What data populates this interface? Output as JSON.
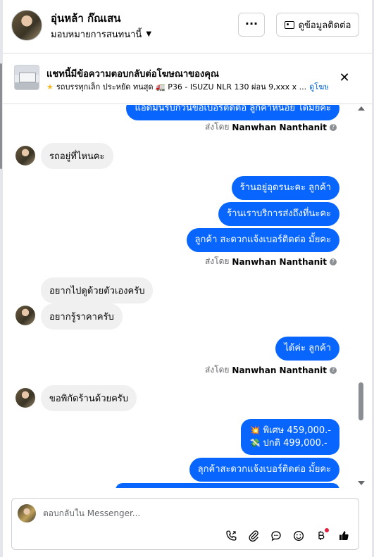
{
  "header": {
    "name": "อุ่นหล้า ก๊ณเสน",
    "subtitle": "มอบหมายการสนทนานี้",
    "more_label": "···",
    "contact_label": "ดูข้อมูลติดต่อ"
  },
  "ad_banner": {
    "title": "แชทนี้มีข้อความตอบกลับต่อโฆษณาของคุณ",
    "description": "รถบรรทุกเล็ก ประหยัด ทนสุด 🚛 P36 - ISUZU NLR 130 ผ่อน 9,xxx x ...",
    "link": "ดูโฆษณา"
  },
  "messages": {
    "out_partial": "แอดมินรบกวนขอเบอร์ติดต่อ ลูกค้าหน่อย ได้มั้ยคะ",
    "sent_by_label": "ส่งโดย",
    "agent_name": "Nanwhan Nanthanit",
    "in_1": "รถอยู่ที่ไหนคะ",
    "out_2": "ร้านอยู่อุดรนะคะ ลูกค้า",
    "out_3": "ร้านเราบริการส่งถึงที่นะคะ",
    "out_4": "ลูกค้า สะดวกแจ้งเบอร์ติดต่อ มั้ยคะ",
    "in_2": "อยากไปดูด้วยตัวเองครับ",
    "in_3": "อยากรู้ราคาครับ",
    "out_5": "ได้ค่ะ ลูกค้า",
    "in_4": "ขอพิกัดร้านด้วยครับ",
    "out_6_line1": "พิเศษ 459,000.-",
    "out_6_line2": "ปกติ 499,000.-",
    "out_7": "ลุกค้าสะดวกแจ้งเบอร์ติดต่อ มั้ยคะ"
  },
  "composer": {
    "placeholder": "ตอบกลับใน Messenger..."
  },
  "icons": {
    "toolbar": [
      "call-icon",
      "attach-icon",
      "saved-reply-icon",
      "emoji-icon",
      "baht-icon",
      "like-icon"
    ]
  },
  "colors": {
    "bubble_out": "#0866ff",
    "bubble_in": "#f0f0f0",
    "link": "#0064d1"
  }
}
